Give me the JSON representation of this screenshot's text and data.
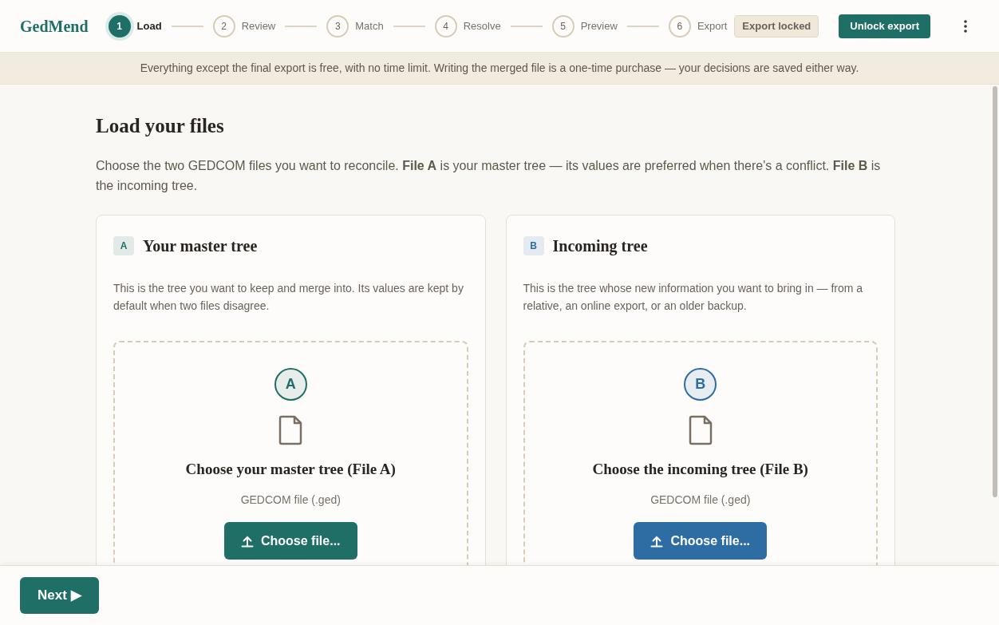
{
  "header": {
    "logo": "GedMend",
    "steps": [
      {
        "number": "1",
        "label": "Load",
        "selected": true
      },
      {
        "number": "2",
        "label": "Review",
        "selected": false
      },
      {
        "number": "3",
        "label": "Match",
        "selected": false
      },
      {
        "number": "4",
        "label": "Resolve",
        "selected": false
      },
      {
        "number": "5",
        "label": "Preview",
        "selected": false
      },
      {
        "number": "6",
        "label": "Export",
        "selected": false
      }
    ],
    "status_badge": "Export locked",
    "unlock_button": "Unlock export"
  },
  "banner": "Everything except the final export is free, with no time limit. Writing the merged file is a one-time purchase — your decisions are saved either way.",
  "main": {
    "title": "Load your files",
    "intro": "Choose the two GEDCOM files you want to reconcile. **File A** is your master tree — its values are preferred when there's a conflict. **File B** is the incoming tree.",
    "cards": [
      {
        "badge": "A",
        "title": "Your master tree",
        "color": "#1f6f66",
        "description": "This is the tree you want to keep and merge into. Its values are kept by default when two files disagree.",
        "drop_letter": "A",
        "drop_title": "Choose your master tree (File A)",
        "drop_hint": "GEDCOM file (.ged)",
        "button": "Choose file..."
      },
      {
        "badge": "B",
        "title": "Incoming tree",
        "color": "#2e6da4",
        "description": "This is the tree whose new information you want to bring in — from a relative, an online export, or an older backup.",
        "drop_letter": "B",
        "drop_title": "Choose the incoming tree (File B)",
        "drop_hint": "GEDCOM file (.ged)",
        "button": "Choose file..."
      }
    ]
  },
  "footer": {
    "next_button": "Next ▶"
  }
}
